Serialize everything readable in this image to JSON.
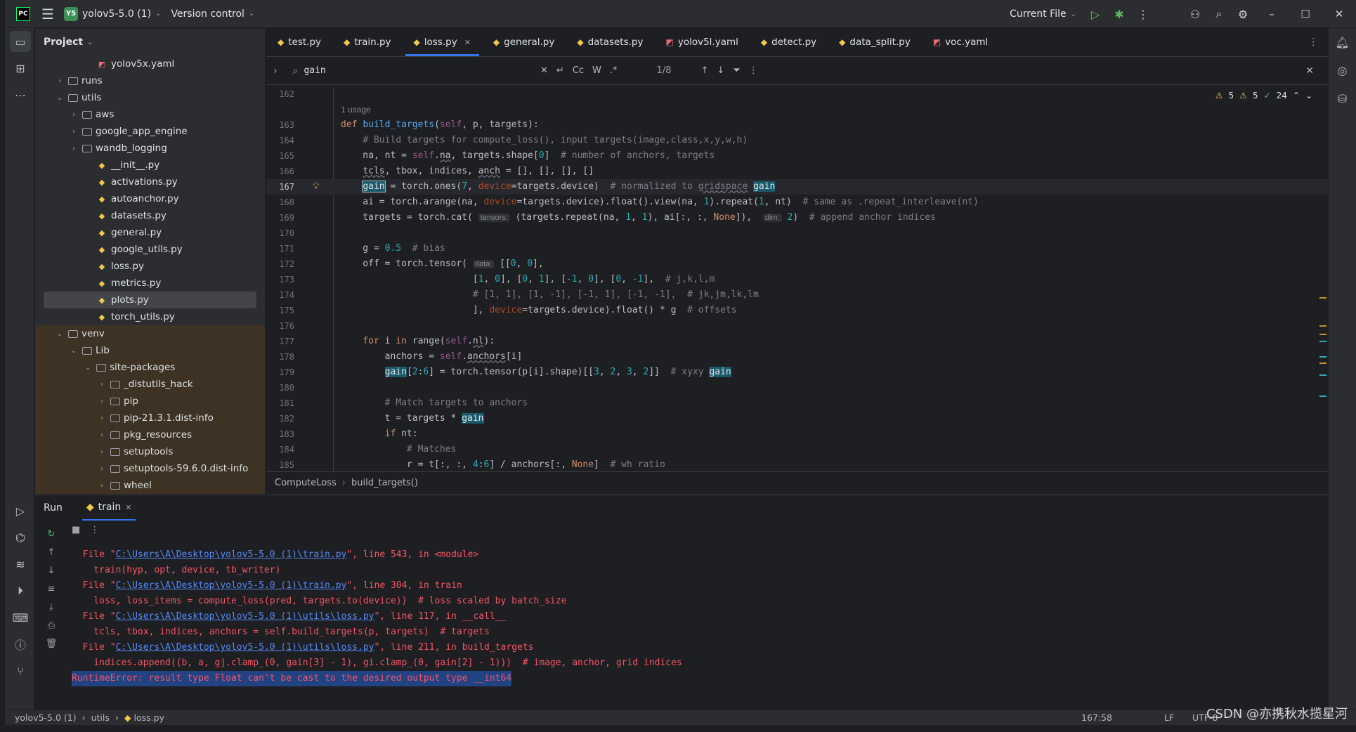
{
  "titlebar": {
    "project_badge": "Y5",
    "project": "yolov5-5.0 (1)",
    "vcs": "Version control",
    "run_config": "Current File"
  },
  "project_panel": {
    "title": "Project",
    "tree": [
      {
        "label": "yolov5x.yaml",
        "type": "yaml",
        "depth": 3
      },
      {
        "label": "runs",
        "type": "folder",
        "depth": 1,
        "arrow": "›"
      },
      {
        "label": "utils",
        "type": "folder",
        "depth": 1,
        "arrow": "⌄"
      },
      {
        "label": "aws",
        "type": "folder",
        "depth": 2,
        "arrow": "›"
      },
      {
        "label": "google_app_engine",
        "type": "folder",
        "depth": 2,
        "arrow": "›"
      },
      {
        "label": "wandb_logging",
        "type": "folder",
        "depth": 2,
        "arrow": "›"
      },
      {
        "label": "__init__.py",
        "type": "py",
        "depth": 3
      },
      {
        "label": "activations.py",
        "type": "py",
        "depth": 3
      },
      {
        "label": "autoanchor.py",
        "type": "py",
        "depth": 3
      },
      {
        "label": "datasets.py",
        "type": "py",
        "depth": 3
      },
      {
        "label": "general.py",
        "type": "py",
        "depth": 3
      },
      {
        "label": "google_utils.py",
        "type": "py",
        "depth": 3
      },
      {
        "label": "loss.py",
        "type": "py",
        "depth": 3
      },
      {
        "label": "metrics.py",
        "type": "py",
        "depth": 3
      },
      {
        "label": "plots.py",
        "type": "py",
        "depth": 3,
        "selected": true
      },
      {
        "label": "torch_utils.py",
        "type": "py",
        "depth": 3
      },
      {
        "label": "venv",
        "type": "folder",
        "depth": 1,
        "arrow": "⌄",
        "excluded": true
      },
      {
        "label": "Lib",
        "type": "folder",
        "depth": 2,
        "arrow": "⌄",
        "excluded": true
      },
      {
        "label": "site-packages",
        "type": "folder",
        "depth": 3,
        "arrow": "⌄",
        "excluded": true
      },
      {
        "label": "_distutils_hack",
        "type": "folder",
        "depth": 4,
        "arrow": "›",
        "excluded": true
      },
      {
        "label": "pip",
        "type": "folder",
        "depth": 4,
        "arrow": "›",
        "excluded": true
      },
      {
        "label": "pip-21.3.1.dist-info",
        "type": "folder",
        "depth": 4,
        "arrow": "›",
        "excluded": true
      },
      {
        "label": "pkg_resources",
        "type": "folder",
        "depth": 4,
        "arrow": "›",
        "excluded": true
      },
      {
        "label": "setuptools",
        "type": "folder",
        "depth": 4,
        "arrow": "›",
        "excluded": true
      },
      {
        "label": "setuptools-59.6.0.dist-info",
        "type": "folder",
        "depth": 4,
        "arrow": "›",
        "excluded": true
      },
      {
        "label": "wheel",
        "type": "folder",
        "depth": 4,
        "arrow": "›",
        "excluded": true
      }
    ]
  },
  "tabs": [
    {
      "label": "test.py",
      "type": "py"
    },
    {
      "label": "train.py",
      "type": "py"
    },
    {
      "label": "loss.py",
      "type": "py",
      "active": true
    },
    {
      "label": "general.py",
      "type": "py"
    },
    {
      "label": "datasets.py",
      "type": "py"
    },
    {
      "label": "yolov5l.yaml",
      "type": "yaml"
    },
    {
      "label": "detect.py",
      "type": "py"
    },
    {
      "label": "data_split.py",
      "type": "py"
    },
    {
      "label": "voc.yaml",
      "type": "yaml"
    }
  ],
  "search": {
    "query": "gain",
    "match_count": "1/8",
    "opts": [
      "Cc",
      "W",
      ".*"
    ]
  },
  "inspections": {
    "warn1": "5",
    "warn2": "5",
    "ok": "24"
  },
  "code": {
    "usage": "1 usage",
    "lines": [
      {
        "n": "162",
        "h": ""
      },
      {
        "n": "163",
        "h": "<span class='kw'>def </span><span class='fn'>build_targets</span>(<span class='sf'>self</span>, p, targets):"
      },
      {
        "n": "164",
        "h": "    <span class='cm'># Build targets for compute_loss(), input targets(image,class,x,y,w,h)</span>"
      },
      {
        "n": "165",
        "h": "    na, nt = <span class='sf'>self</span>.<span class='u'>na</span>, targets.shape[<span class='nm'>0</span>]  <span class='cm'># number of anchors, targets</span>"
      },
      {
        "n": "166",
        "h": "    <span class='u'>tcls</span>, tbox, indices, <span class='u'>anch</span> = [], [], [], []"
      },
      {
        "n": "167",
        "h": "    <span class='hlb'>gain</span> = torch.ones(<span class='nm'>7</span>, <span class='pm'>device</span>=targets.device)  <span class='cm'># normalized to <span class='u'>gridspace</span> </span><span class='hl'>gain</span>",
        "cur": true
      },
      {
        "n": "168",
        "h": "    ai = torch.arange(na, <span class='pm'>device</span>=targets.device).float().view(na, <span class='nm'>1</span>).repeat(<span class='nm'>1</span>, nt)  <span class='cm'># same as .repeat_interleave(nt)</span>"
      },
      {
        "n": "169",
        "h": "    targets = torch.cat( <span class='hn'>tensors:</span> (targets.repeat(na, <span class='nm'>1</span>, <span class='nm'>1</span>), ai[:, :, <span class='kw'>None</span>]),  <span class='hn'>dim:</span> <span class='nm'>2</span>)  <span class='cm'># append anchor indices</span>"
      },
      {
        "n": "170",
        "h": ""
      },
      {
        "n": "171",
        "h": "    g = <span class='nm'>0.5</span>  <span class='cm'># bias</span>"
      },
      {
        "n": "172",
        "h": "    off = torch.tensor( <span class='hn'>data:</span> [[<span class='nm'>0</span>, <span class='nm'>0</span>],"
      },
      {
        "n": "173",
        "h": "                        [<span class='nm'>1</span>, <span class='nm'>0</span>], [<span class='nm'>0</span>, <span class='nm'>1</span>], [<span class='nm'>-1</span>, <span class='nm'>0</span>], [<span class='nm'>0</span>, <span class='nm'>-1</span>],  <span class='cm'># j,k,l,m</span>"
      },
      {
        "n": "174",
        "h": "                        <span class='cm'># [1, 1], [1, -1], [-1, 1], [-1, -1],  # jk,jm,lk,lm</span>"
      },
      {
        "n": "175",
        "h": "                        ], <span class='pm'>device</span>=targets.device).float() * g  <span class='cm'># offsets</span>"
      },
      {
        "n": "176",
        "h": ""
      },
      {
        "n": "177",
        "h": "    <span class='kw'>for </span>i <span class='kw'>in </span>range(<span class='sf'>self</span>.<span class='u'>nl</span>):"
      },
      {
        "n": "178",
        "h": "        anchors = <span class='sf'>self</span>.<span class='u'>anchors</span>[i]"
      },
      {
        "n": "179",
        "h": "        <span class='hl'>gain</span>[<span class='nm'>2</span>:<span class='nm'>6</span>] = torch.tensor(p[i].shape)[[<span class='nm'>3</span>, <span class='nm'>2</span>, <span class='nm'>3</span>, <span class='nm'>2</span>]]  <span class='cm'># xyxy </span><span class='hl'>gain</span>"
      },
      {
        "n": "180",
        "h": ""
      },
      {
        "n": "181",
        "h": "        <span class='cm'># Match targets to anchors</span>"
      },
      {
        "n": "182",
        "h": "        t = targets * <span class='hl'>gain</span>"
      },
      {
        "n": "183",
        "h": "        <span class='kw'>if </span>nt:"
      },
      {
        "n": "184",
        "h": "            <span class='cm'># Matches</span>"
      },
      {
        "n": "185",
        "h": "            r = t[:, :, <span class='nm'>4</span>:<span class='nm'>6</span>] / anchors[:, <span class='kw'>None</span>]  <span class='cm'># wh ratio</span>"
      }
    ]
  },
  "breadcrumbs": [
    "ComputeLoss",
    "build_targets()"
  ],
  "run": {
    "title": "Run",
    "tab": "train",
    "lines": [
      {
        "pre": "  File \"",
        "link": "C:\\Users\\A\\Desktop\\yolov5-5.0 (1)\\train.py",
        "post": "\", line 543, in <module>"
      },
      {
        "text": "    train(hyp, opt, device, tb_writer)"
      },
      {
        "pre": "  File \"",
        "link": "C:\\Users\\A\\Desktop\\yolov5-5.0 (1)\\train.py",
        "post": "\", line 304, in train"
      },
      {
        "text": "    loss, loss_items = compute_loss(pred, targets.to(device))  # loss scaled by batch_size"
      },
      {
        "pre": "  File \"",
        "link": "C:\\Users\\A\\Desktop\\yolov5-5.0 (1)\\utils\\loss.py",
        "post": "\", line 117, in __call__"
      },
      {
        "text": "    tcls, tbox, indices, anchors = self.build_targets(p, targets)  # targets"
      },
      {
        "pre": "  File \"",
        "link": "C:\\Users\\A\\Desktop\\yolov5-5.0 (1)\\utils\\loss.py",
        "post": "\", line 211, in build_targets"
      },
      {
        "text": "    indices.append((b, a, gj.clamp_(0, gain[3] - 1), gi.clamp_(0, gain[2] - 1)))  # image, anchor, grid indices"
      },
      {
        "error": "RuntimeError: result type Float can't be cast to the desired output type __int64"
      }
    ]
  },
  "status": {
    "crumbs": [
      "yolov5-5.0 (1)",
      "utils",
      "loss.py"
    ],
    "pos": "167:58",
    "sep": "LF",
    "enc": "UTF-8"
  },
  "watermark": "CSDN @亦携秋水揽星河"
}
